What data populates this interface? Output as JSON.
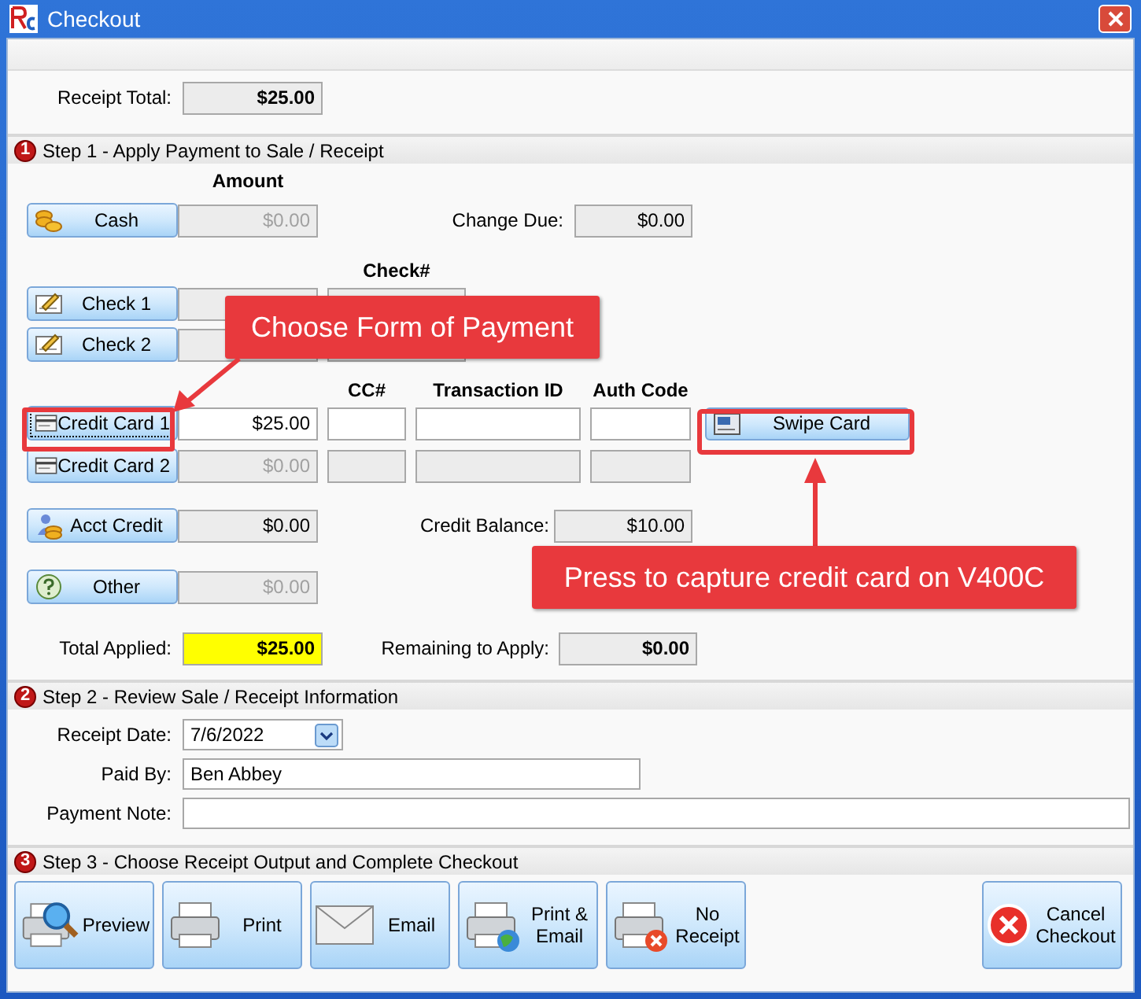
{
  "window": {
    "title": "Checkout"
  },
  "receipt_total": {
    "label": "Receipt Total:",
    "value": "$25.00"
  },
  "step1": {
    "number": "1",
    "title": "Step 1 - Apply Payment to Sale / Receipt",
    "amount_header": "Amount",
    "check_header": "Check#",
    "cc_headers": [
      "CC#",
      "Transaction ID",
      "Auth Code"
    ],
    "payments": [
      {
        "kind": "cash",
        "label": "Cash",
        "amount": "$0.00",
        "editable": false,
        "disabled": true,
        "focused": false,
        "side_label": "Change Due:",
        "side_value": "$0.00"
      },
      {
        "kind": "check",
        "label": "Check 1",
        "editable": false,
        "focused": false
      },
      {
        "kind": "check",
        "label": "Check 2",
        "editable": false,
        "focused": false
      },
      {
        "kind": "card",
        "label": "Credit Card 1",
        "amount": "$25.00",
        "editable": true,
        "disabled": false,
        "focused": true,
        "swipe": "Swipe Card"
      },
      {
        "kind": "card",
        "label": "Credit Card 2",
        "amount": "$0.00",
        "editable": false,
        "disabled": true,
        "focused": false
      },
      {
        "kind": "account",
        "label": "Acct Credit",
        "amount": "$0.00",
        "editable": false,
        "disabled": false,
        "focused": false,
        "side_label": "Credit Balance:",
        "side_value": "$10.00"
      },
      {
        "kind": "other",
        "label": "Other",
        "amount": "$0.00",
        "editable": false,
        "disabled": true,
        "focused": false
      }
    ],
    "total_applied": {
      "label": "Total Applied:",
      "value": "$25.00"
    },
    "remaining": {
      "label": "Remaining to Apply:",
      "value": "$0.00"
    }
  },
  "step2": {
    "number": "2",
    "title": "Step 2 - Review Sale / Receipt Information",
    "receipt_date": {
      "label": "Receipt Date:",
      "value": "7/6/2022"
    },
    "paid_by": {
      "label": "Paid By:",
      "value": "Ben Abbey"
    },
    "payment_note": {
      "label": "Payment Note:"
    }
  },
  "step3": {
    "number": "3",
    "title": "Step 3 - Choose Receipt Output and Complete Checkout",
    "buttons": [
      {
        "kind": "preview",
        "label": "Preview"
      },
      {
        "kind": "print",
        "label": "Print"
      },
      {
        "kind": "email",
        "label": "Email"
      },
      {
        "kind": "print_email",
        "label": "Print & Email"
      },
      {
        "kind": "no_receipt",
        "label": "No Receipt"
      },
      {
        "kind": "cancel",
        "label": "Cancel Checkout"
      }
    ]
  },
  "annotations": [
    {
      "kind": "form_of_payment",
      "text": "Choose Form of Payment"
    },
    {
      "kind": "swipe",
      "text": "Press to capture credit card on V400C"
    }
  ]
}
